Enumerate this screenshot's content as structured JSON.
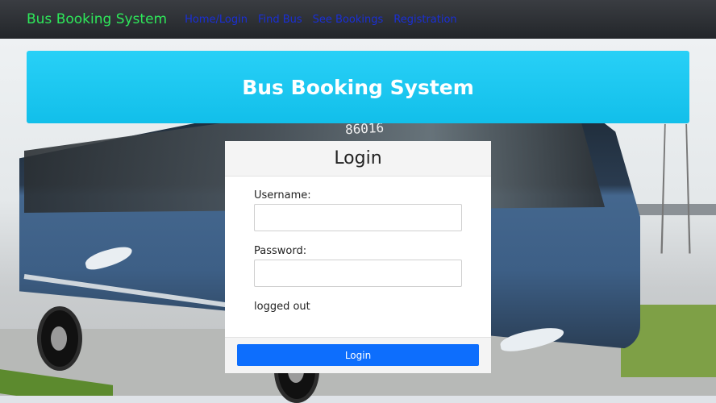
{
  "navbar": {
    "brand": "Bus Booking System",
    "links": [
      "Home/Login",
      "Find Bus",
      "See Bookings",
      "Registration"
    ]
  },
  "background": {
    "bus_number": "86016"
  },
  "banner": {
    "title": "Bus Booking System"
  },
  "login": {
    "title": "Login",
    "username_label": "Username:",
    "username_value": "",
    "password_label": "Password:",
    "password_value": "",
    "status": "logged out",
    "button_label": "Login"
  },
  "colors": {
    "brand": "#2ee85a",
    "nav_link": "#1a2fd6",
    "banner": "#17c4ee",
    "button": "#0d6efd"
  }
}
